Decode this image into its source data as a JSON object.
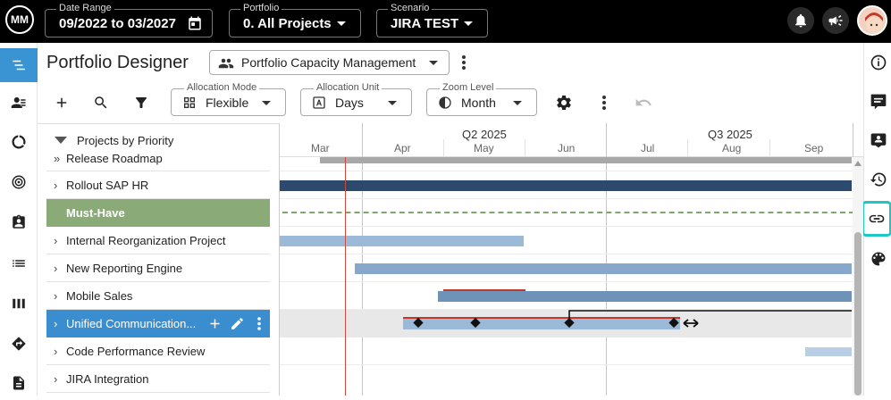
{
  "topbar": {
    "date_range": {
      "label": "Date Range",
      "value": "09/2022 to 03/2027"
    },
    "portfolio": {
      "label": "Portfolio",
      "value": "0. All Projects"
    },
    "scenario": {
      "label": "Scenario",
      "value": "JIRA TEST"
    },
    "logo_text": "MM"
  },
  "header": {
    "title": "Portfolio Designer",
    "view": "Portfolio Capacity Management"
  },
  "toolbar": {
    "allocation_mode": {
      "label": "Allocation Mode",
      "value": "Flexible"
    },
    "allocation_unit": {
      "label": "Allocation Unit",
      "value": "Days"
    },
    "zoom_level": {
      "label": "Zoom Level",
      "value": "Month"
    }
  },
  "list": {
    "header": "Projects by Priority",
    "rows": [
      {
        "label": "Release Roadmap",
        "type": "project"
      },
      {
        "label": "Rollout SAP HR",
        "type": "project"
      },
      {
        "label": "Must-Have",
        "type": "group"
      },
      {
        "label": "Internal Reorganization Project",
        "type": "project"
      },
      {
        "label": "New Reporting Engine",
        "type": "project"
      },
      {
        "label": "Mobile Sales",
        "type": "project"
      },
      {
        "label": "Unified Communication...",
        "type": "project",
        "selected": true
      },
      {
        "label": "Code Performance Review",
        "type": "project"
      },
      {
        "label": "JIRA Integration",
        "type": "project"
      }
    ]
  },
  "timeline": {
    "quarters": [
      "Q2 2025",
      "Q3 2025"
    ],
    "months": [
      "Mar",
      "Apr",
      "May",
      "Jun",
      "Jul",
      "Aug",
      "Sep"
    ]
  },
  "colors": {
    "accent": "#3a8ed0",
    "group": "#8aab78",
    "bar_dark": "#2c4a6e",
    "bar_light": "#9bbad8",
    "bar_mid": "#6f92b8",
    "today_line": "#d04a3a",
    "linked_active": "#1fc6c6"
  }
}
